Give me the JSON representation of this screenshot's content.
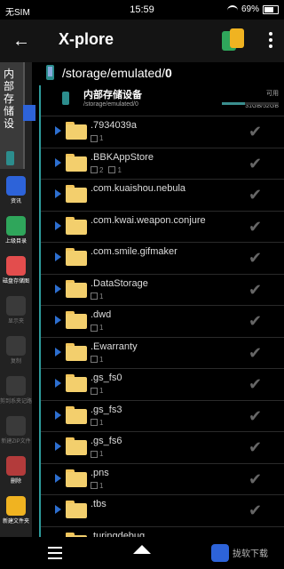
{
  "status": {
    "carrier": "无SIM",
    "time": "15:59",
    "battery": "69%"
  },
  "appbar": {
    "title": "X-plore"
  },
  "pathbar": {
    "prefix": "/storage/emulated/",
    "last": "0"
  },
  "side": {
    "tab_label": "内部存储设",
    "tools": [
      {
        "label": "资讯",
        "color": "#2d63d9"
      },
      {
        "label": "上级目录",
        "color": "#2fa65b"
      },
      {
        "label": "磁盘存储图",
        "color": "#e34d4d"
      },
      {
        "label": "显示夹",
        "color": "#3a3a3a"
      },
      {
        "label": "复制",
        "color": "#3a3a3a"
      },
      {
        "label": "剪到系夹记路",
        "color": "#3a3a3a"
      },
      {
        "label": "新建ZIP文件",
        "color": "#3a3a3a"
      },
      {
        "label": "删除",
        "color": "#b33b3b"
      },
      {
        "label": "新建文件夹",
        "color": "#f0b321"
      }
    ]
  },
  "storage": {
    "name": "内部存储设备",
    "path": "/storage/emulated/0",
    "avail_label": "可用",
    "size": "31GB/52GB",
    "used_fraction": 0.4
  },
  "files": [
    {
      "name": ".7934039a",
      "folders": "",
      "files": "1"
    },
    {
      "name": ".BBKAppStore",
      "folders": "2",
      "files": "1"
    },
    {
      "name": ".com.kuaishou.nebula",
      "folders": "",
      "files": ""
    },
    {
      "name": ".com.kwai.weapon.conjure",
      "folders": "",
      "files": ""
    },
    {
      "name": ".com.smile.gifmaker",
      "folders": "",
      "files": ""
    },
    {
      "name": ".DataStorage",
      "folders": "",
      "files": "1"
    },
    {
      "name": ".dwd",
      "folders": "",
      "files": "1"
    },
    {
      "name": ".Ewarranty",
      "folders": "",
      "files": "1"
    },
    {
      "name": ".gs_fs0",
      "folders": "",
      "files": "1"
    },
    {
      "name": ".gs_fs3",
      "folders": "",
      "files": "1"
    },
    {
      "name": ".gs_fs6",
      "folders": "",
      "files": "1"
    },
    {
      "name": ".pns",
      "folders": "",
      "files": "1"
    },
    {
      "name": ".tbs",
      "folders": "",
      "files": ""
    },
    {
      "name": ".turingdebug",
      "folders": "",
      "files": ""
    }
  ],
  "watermark": "拢软下载"
}
